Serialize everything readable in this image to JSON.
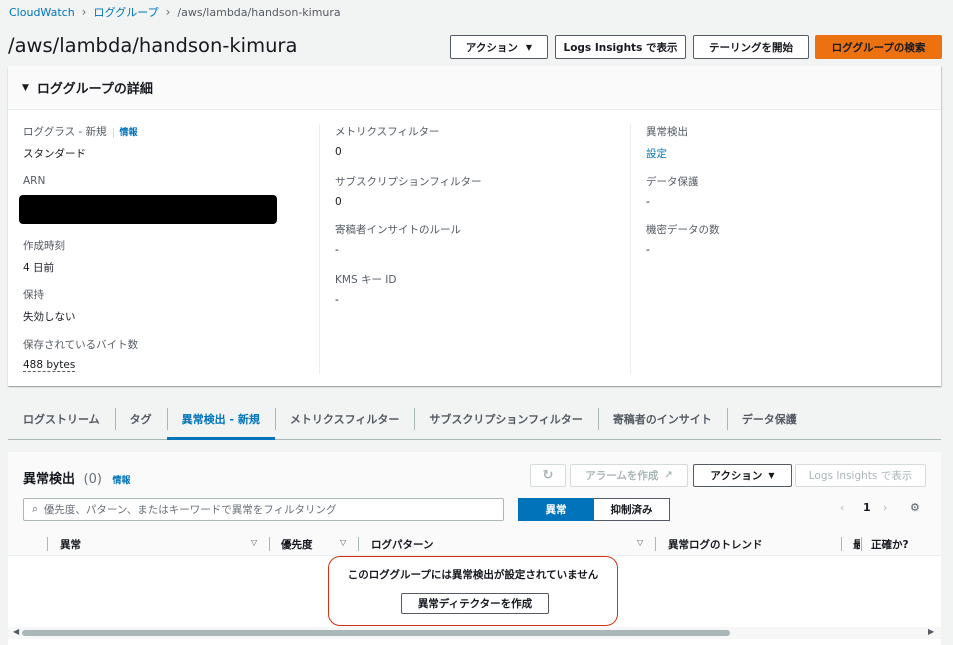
{
  "breadcrumb": {
    "items": [
      "CloudWatch",
      "ロググループ"
    ],
    "current": "/aws/lambda/handson-kimura"
  },
  "header": {
    "title": "/aws/lambda/handson-kimura",
    "actions_label": "アクション",
    "logs_insights_label": "Logs Insights で表示",
    "tailing_label": "テーリングを開始",
    "search_label": "ロググループの検索"
  },
  "details": {
    "title": "ロググループの詳細",
    "log_class_label": "ロググラス - 新規",
    "info_label": "情報",
    "log_class_value": "スタンダード",
    "arn_label": "ARN",
    "created_label": "作成時刻",
    "created_value": "4 日前",
    "retention_label": "保持",
    "retention_value": "失効しない",
    "stored_bytes_label": "保存されているバイト数",
    "stored_bytes_value": "488 bytes",
    "metric_filter_label": "メトリクスフィルター",
    "metric_filter_value": "0",
    "subscription_filter_label": "サブスクリプションフィルター",
    "subscription_filter_value": "0",
    "contributor_rules_label": "寄稿者インサイトのルール",
    "contributor_rules_value": "-",
    "kms_label": "KMS キー ID",
    "kms_value": "-",
    "anomaly_label": "異常検出",
    "anomaly_value": "設定",
    "data_protection_label": "データ保護",
    "data_protection_value": "-",
    "sensitive_label": "機密データの数",
    "sensitive_value": "-"
  },
  "tabs": [
    {
      "label": "ログストリーム"
    },
    {
      "label": "タグ"
    },
    {
      "label": "異常検出 - 新規"
    },
    {
      "label": "メトリクスフィルター"
    },
    {
      "label": "サブスクリプションフィルター"
    },
    {
      "label": "寄稿者のインサイト"
    },
    {
      "label": "データ保護"
    }
  ],
  "anomaly": {
    "title": "異常検出",
    "count": "(0)",
    "info_label": "情報",
    "create_alarm_label": "アラームを作成",
    "actions_label": "アクション",
    "logs_insights_label": "Logs Insights で表示",
    "search_placeholder": "優先度、パターン、またはキーワードで異常をフィルタリング",
    "seg_anomaly": "異常",
    "seg_suppressed": "抑制済み",
    "page": "1",
    "columns": [
      "異常",
      "優先度",
      "ログパターン",
      "異常ログのトレンド",
      "最",
      "正確か?"
    ],
    "empty_message": "このロググループには異常検出が設定されていません",
    "create_detector_label": "異常ディテクターを作成"
  }
}
